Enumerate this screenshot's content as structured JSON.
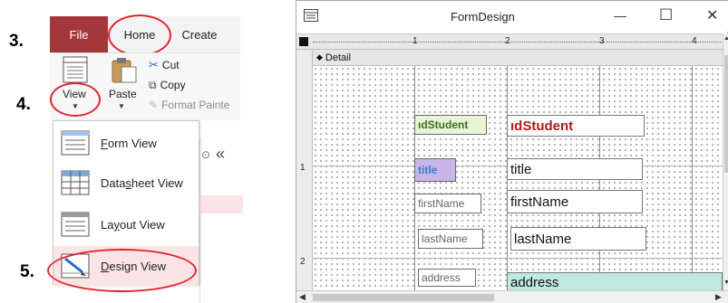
{
  "steps": {
    "s3": "3.",
    "s4": "4.",
    "s5": "5."
  },
  "ribbon": {
    "tabs": {
      "file": "File",
      "home": "Home",
      "create": "Create"
    },
    "view_label": "View",
    "paste_label": "Paste",
    "cut_label": "Cut",
    "copy_label": "Copy",
    "format_painter_label": "Format Painte",
    "collapse_glyph": "«",
    "dropdown_glyph": "⊙"
  },
  "view_menu": {
    "items": [
      {
        "label": "Form View",
        "accel": "F",
        "rest": "orm View"
      },
      {
        "label": "Datasheet View",
        "pre": "Data",
        "accel": "s",
        "rest": "heet View"
      },
      {
        "label": "Layout View",
        "pre": "La",
        "accel": "y",
        "rest": "out View"
      },
      {
        "label": "Design View",
        "accel": "D",
        "rest": "esign View"
      }
    ]
  },
  "window": {
    "title": "FormDesign",
    "minimize_glyph": "—",
    "maximize_glyph": "☐",
    "close_glyph": "✕",
    "ruler_marks": [
      "1",
      "2",
      "3",
      "4"
    ],
    "vruler_marks": [
      "1",
      "2"
    ],
    "section_label": "Detail",
    "section_glyph": "◆"
  },
  "form_controls": {
    "idstudent_label": "ıdStudent",
    "idstudent_text": "ıdStudent",
    "title_label": "title",
    "title_text": "title",
    "firstname_label": "firstName",
    "firstname_text": "firstName",
    "lastname_label": "lastName",
    "lastname_text": "lastName",
    "address_label": "address",
    "address_text": "address"
  },
  "colors": {
    "file_tab": "#a4373a",
    "highlight_ring": "#e0262d",
    "design_view_bg": "#fbe4e6",
    "idstudent_label_bg": "#e9f3d6",
    "idstudent_text_color": "#b3171e",
    "title_label_bg": "#c8b6e8",
    "title_label_text": "#3a7fd0",
    "address_text_bg": "#bfe9dd"
  }
}
